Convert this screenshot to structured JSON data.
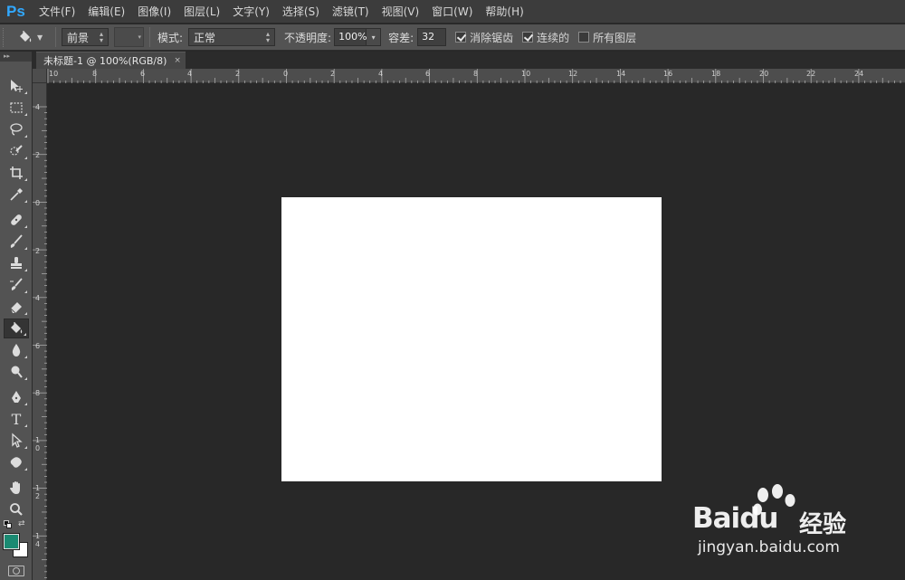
{
  "app": {
    "logo": "Ps"
  },
  "menu": [
    "文件(F)",
    "编辑(E)",
    "图像(I)",
    "图层(L)",
    "文字(Y)",
    "选择(S)",
    "滤镜(T)",
    "视图(V)",
    "窗口(W)",
    "帮助(H)"
  ],
  "options": {
    "fill_source": "前景",
    "mode_label": "模式:",
    "mode_value": "正常",
    "opacity_label": "不透明度:",
    "opacity_value": "100%",
    "tolerance_label": "容差:",
    "tolerance_value": "32",
    "antialias_label": "消除锯齿",
    "antialias_checked": true,
    "contiguous_label": "连续的",
    "contiguous_checked": true,
    "all_layers_label": "所有图层",
    "all_layers_checked": false
  },
  "document_tab": {
    "title": "未标题-1 @ 100%(RGB/8)",
    "close": "×"
  },
  "toolbox": {
    "collapse": "▸▸",
    "active_tool": "paint-bucket",
    "foreground_color": "#1a8a72",
    "background_color": "#ffffff",
    "type_tool_glyph": "T"
  },
  "rulers": {
    "top": [
      "10",
      "8",
      "6",
      "4",
      "2",
      "0",
      "2",
      "4",
      "6",
      "8",
      "10",
      "12",
      "14",
      "16",
      "18",
      "20",
      "22",
      "24"
    ],
    "left": [
      "4",
      "2",
      "0",
      "2",
      "4",
      "6",
      "8",
      "1 0",
      "1 2",
      "1 4"
    ]
  },
  "canvas": {
    "background": "#ffffff"
  },
  "watermark": {
    "brand": "Bai",
    "brand_du": "du",
    "brand_cn": "经验",
    "url": "jingyan.baidu.com"
  }
}
